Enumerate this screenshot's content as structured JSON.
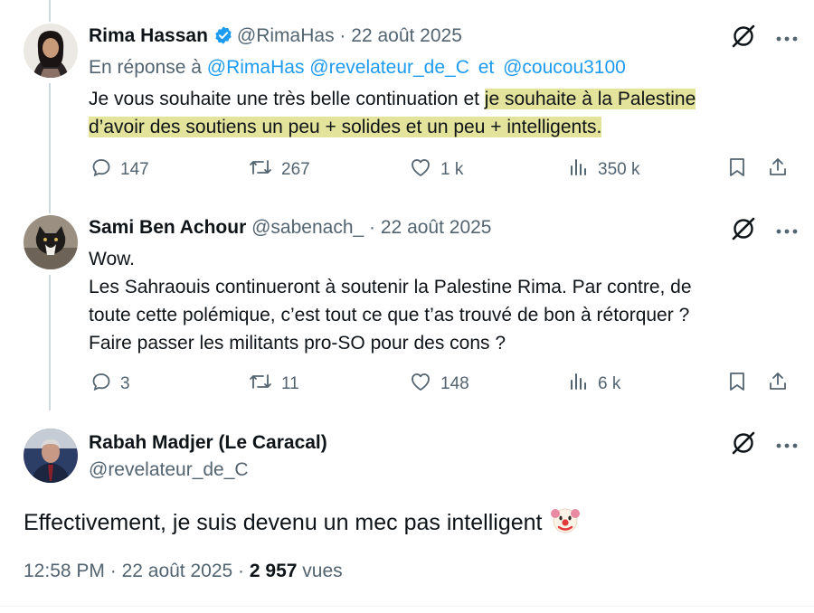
{
  "tweets": [
    {
      "name": "Rima Hassan",
      "handle": "@RimaHas",
      "sep": "·",
      "date": "22 août 2025",
      "reply_prefix": "En réponse à",
      "reply_mentions": [
        "@RimaHas",
        "@revelateur_de_C",
        "et",
        "@coucou3100"
      ],
      "text_line1_plain": "Je vous souhaite une très belle continuation et ",
      "text_line1_highlight": "je souhaite à la Palestine",
      "text_line2_highlight": "d’avoir des soutiens un peu + solides et un peu + intelligents.",
      "replies": "147",
      "reposts": "267",
      "likes": "1 k",
      "views": "350 k"
    },
    {
      "name": "Sami Ben Achour",
      "handle": "@sabenach_",
      "sep": "·",
      "date": "22 août 2025",
      "lines": [
        "Wow.",
        "Les Sahraouis continueront à soutenir la Palestine Rima. Par contre, de",
        "toute cette polémique, c’est tout ce que t’as trouvé de bon à rétorquer ?",
        "Faire passer les militants pro-SO pour des cons ?"
      ],
      "replies": "3",
      "reposts": "11",
      "likes": "148",
      "views": "6 k"
    }
  ],
  "focus": {
    "name": "Rabah Madjer (Le Caracal)",
    "handle": "@revelateur_de_C",
    "text": "Effectivement, je suis devenu un mec pas intelligent",
    "emoji": "🤡",
    "time": "12:58 PM",
    "sep": "·",
    "date": "22 août 2025",
    "sep2": "·",
    "views_count": "2 957",
    "views_label": "vues"
  },
  "colors": {
    "verified": "#1d9bf0",
    "mention": "#1d9bf0",
    "highlight": "#e4e39b",
    "muted": "#536471"
  },
  "icons": [
    "verified-badge-icon",
    "grok-icon",
    "more-icon",
    "reply-icon",
    "repost-icon",
    "like-icon",
    "views-icon",
    "bookmark-icon",
    "share-icon",
    "clown-emoji"
  ]
}
